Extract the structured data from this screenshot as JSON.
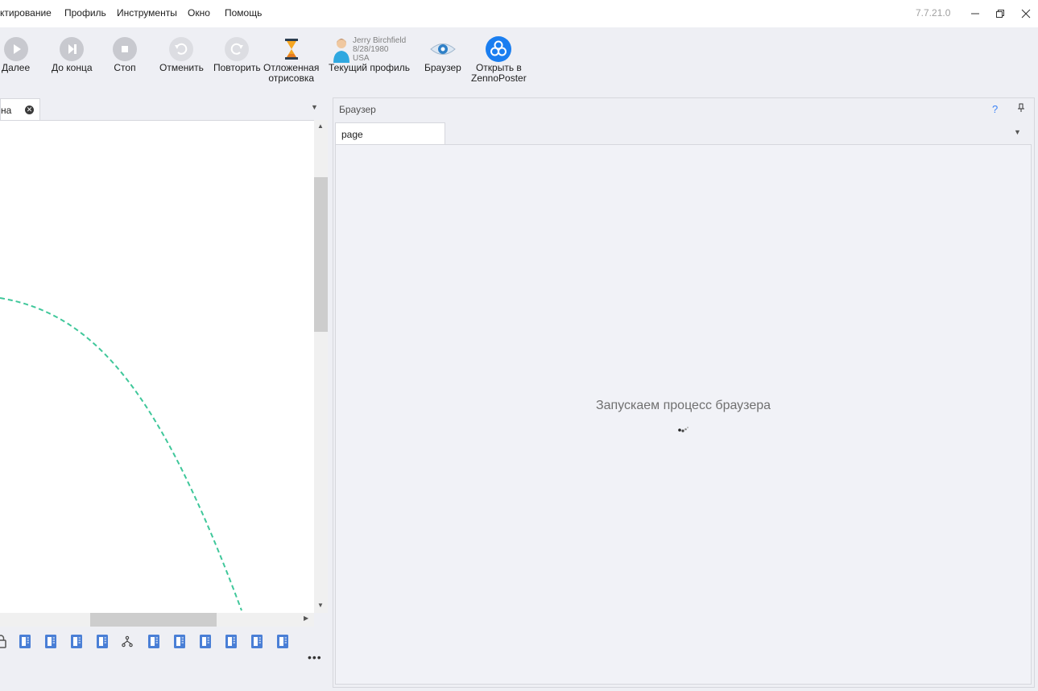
{
  "menu": {
    "items": [
      "ктирование",
      "Профиль",
      "Инструменты",
      "Окно",
      "Помощь"
    ],
    "version": "7.7.21.0"
  },
  "toolbar": {
    "next_label": "Далее",
    "to_end_label": "До конца",
    "stop_label": "Стоп",
    "undo_label": "Отменить",
    "redo_label": "Повторить",
    "deferred_label_1": "Отложенная",
    "deferred_label_2": "отрисовка",
    "current_profile_label": "Текущий профиль",
    "browser_label": "Браузер",
    "open_in_label_1": "Открыть в",
    "open_in_label_2": "ZennoPoster"
  },
  "profile": {
    "name": "Jerry Birchfield",
    "birthdate": "8/28/1980",
    "country": "USA"
  },
  "left_panel": {
    "tab_label": "на"
  },
  "right_panel": {
    "title": "Браузер",
    "help": "?",
    "tab_label": "page",
    "loading_text": "Запускаем процесс браузера"
  },
  "colors": {
    "accent": "#1a7ef0",
    "connector": "#3fc79a",
    "block_icon": "#4a7fd6"
  },
  "icons": {
    "next": "play-icon",
    "to_end": "skip-end-icon",
    "stop": "stop-icon",
    "undo": "undo-icon",
    "redo": "redo-icon",
    "deferred": "hourglass-icon",
    "profile": "user-avatar-icon",
    "browser": "eye-icon",
    "zennoposter": "zennoposter-logo-icon"
  }
}
